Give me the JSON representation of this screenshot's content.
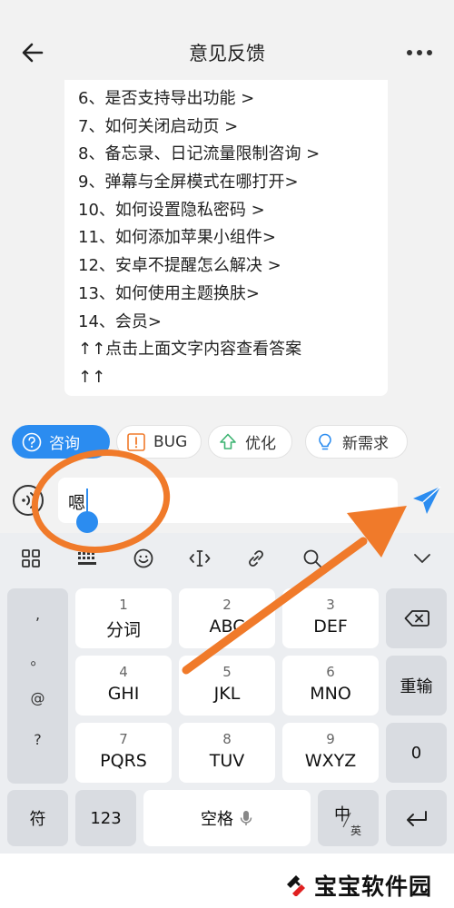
{
  "header": {
    "title": "意见反馈"
  },
  "faq": {
    "items": [
      "6、是否支持导出功能 >",
      "7、如何关闭启动页 >",
      "8、备忘录、日记流量限制咨询 >",
      "9、弹幕与全屏模式在哪打开>",
      "10、如何设置隐私密码 >",
      "11、如何添加苹果小组件>",
      "12、安卓不提醒怎么解决 >",
      "13、如何使用主题换肤>",
      "14、会员>",
      "↑↑点击上面文字内容查看答案",
      "↑↑"
    ]
  },
  "quick_actions": {
    "consult": "咨询",
    "bug": "BUG",
    "optimize": "优化",
    "new_request": "新需求"
  },
  "input": {
    "value": "嗯"
  },
  "keyboard": {
    "punct": [
      ",",
      "。",
      "@",
      "?"
    ],
    "row1": [
      {
        "num": "1",
        "letters": "分词"
      },
      {
        "num": "2",
        "letters": "ABC"
      },
      {
        "num": "3",
        "letters": "DEF"
      }
    ],
    "row2": [
      {
        "num": "4",
        "letters": "GHI"
      },
      {
        "num": "5",
        "letters": "JKL"
      },
      {
        "num": "6",
        "letters": "MNO"
      }
    ],
    "row3": [
      {
        "num": "7",
        "letters": "PQRS"
      },
      {
        "num": "8",
        "letters": "TUV"
      },
      {
        "num": "9",
        "letters": "WXYZ"
      }
    ],
    "reenter": "重输",
    "zero": "0",
    "symbol": "符",
    "num_switch": "123",
    "space": "空格",
    "lang_cn": "中",
    "lang_en": "英"
  },
  "watermark": {
    "text": "宝宝软件园"
  },
  "colors": {
    "accent": "#2b8cf0",
    "annotation": "#f07a2a"
  }
}
